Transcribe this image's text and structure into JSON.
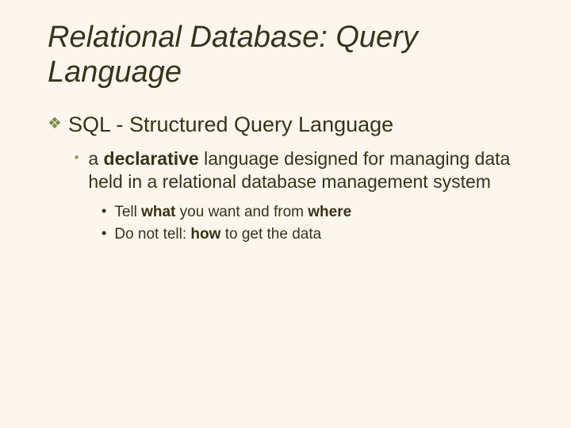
{
  "title": "Relational Database: Query Language",
  "lvl1_text": "SQL - Structured Query Language",
  "lvl2_html": "a <b>declarative</b> language designed for managing data held in a relational database management system",
  "lvl3": [
    "Tell <b>what</b> you want and from <b>where</b>",
    "Do not tell: <b>how</b> to get the data"
  ]
}
